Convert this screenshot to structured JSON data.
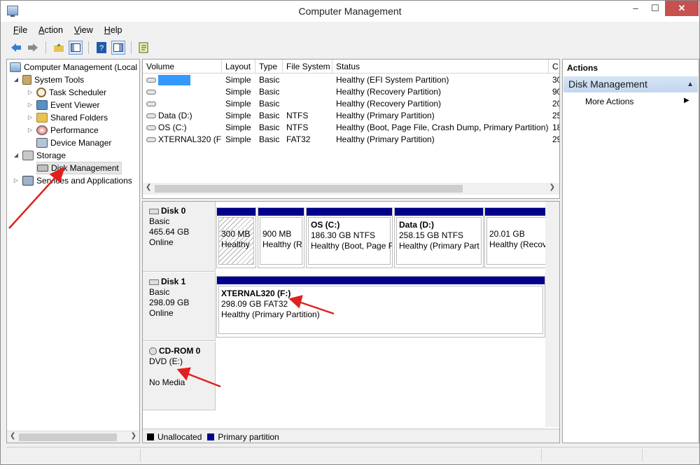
{
  "window": {
    "title": "Computer Management",
    "controls": {
      "minimize": "‒",
      "maximize": "☐",
      "close": "✕"
    }
  },
  "menubar": [
    {
      "key": "F",
      "rest": "ile"
    },
    {
      "key": "A",
      "rest": "ction"
    },
    {
      "key": "V",
      "rest": "iew"
    },
    {
      "key": "H",
      "rest": "elp"
    }
  ],
  "toolbar": [
    "back-icon",
    "forward-icon",
    "up-folder-icon",
    "show-hide-tree-icon",
    "help-icon",
    "properties-icon",
    "export-icon"
  ],
  "tree": {
    "root": "Computer Management (Local",
    "system_tools": "System Tools",
    "task_scheduler": "Task Scheduler",
    "event_viewer": "Event Viewer",
    "shared_folders": "Shared Folders",
    "performance": "Performance",
    "device_manager": "Device Manager",
    "storage": "Storage",
    "disk_management": "Disk Management",
    "services_apps": "Services and Applications"
  },
  "volumes": {
    "columns": [
      "Volume",
      "Layout",
      "Type",
      "File System",
      "Status",
      "C"
    ],
    "rows": [
      {
        "volume": "",
        "layout": "Simple",
        "type": "Basic",
        "fs": "",
        "status": "Healthy (EFI System Partition)",
        "c": "30"
      },
      {
        "volume": "",
        "layout": "Simple",
        "type": "Basic",
        "fs": "",
        "status": "Healthy (Recovery Partition)",
        "c": "90"
      },
      {
        "volume": "",
        "layout": "Simple",
        "type": "Basic",
        "fs": "",
        "status": "Healthy (Recovery Partition)",
        "c": "20"
      },
      {
        "volume": "Data (D:)",
        "layout": "Simple",
        "type": "Basic",
        "fs": "NTFS",
        "status": "Healthy (Primary Partition)",
        "c": "25"
      },
      {
        "volume": "OS (C:)",
        "layout": "Simple",
        "type": "Basic",
        "fs": "NTFS",
        "status": "Healthy (Boot, Page File, Crash Dump, Primary Partition)",
        "c": "18"
      },
      {
        "volume": "XTERNAL320 (F:)",
        "layout": "Simple",
        "type": "Basic",
        "fs": "FAT32",
        "status": "Healthy (Primary Partition)",
        "c": "29"
      }
    ]
  },
  "disks": {
    "disk0": {
      "name": "Disk 0",
      "type": "Basic",
      "size": "465.64 GB",
      "state": "Online",
      "partitions": [
        {
          "title": "",
          "size": "300 MB",
          "status": "Healthy"
        },
        {
          "title": "",
          "size": "900 MB",
          "status": "Healthy (R"
        },
        {
          "title": "OS  (C:)",
          "size": "186.30 GB NTFS",
          "status": "Healthy (Boot, Page F"
        },
        {
          "title": "Data  (D:)",
          "size": "258.15 GB NTFS",
          "status": "Healthy (Primary Part"
        },
        {
          "title": "",
          "size": "20.01 GB",
          "status": "Healthy (Recover"
        }
      ]
    },
    "disk1": {
      "name": "Disk 1",
      "type": "Basic",
      "size": "298.09 GB",
      "state": "Online",
      "partition": {
        "title": "XTERNAL320  (F:)",
        "size": "298.09 GB FAT32",
        "status": "Healthy (Primary Partition)"
      }
    },
    "cdrom": {
      "name": "CD-ROM 0",
      "type": "DVD (E:)",
      "media": "No Media"
    }
  },
  "legend": {
    "unallocated": "Unallocated",
    "primary": "Primary partition"
  },
  "colors": {
    "primary": "#00008b",
    "unallocated": "#000000",
    "selection": "#3399ff",
    "arrow": "#e02020"
  },
  "actions": {
    "title": "Actions",
    "section": "Disk Management",
    "more": "More Actions"
  }
}
